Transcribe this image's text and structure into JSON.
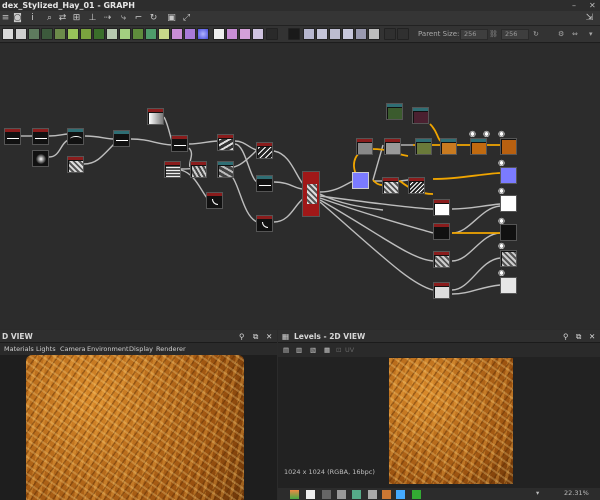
{
  "window": {
    "title": "dex_Stylized_Hay_01 - GRAPH",
    "minimize_icon": "minus-icon",
    "close_icon": "close-icon"
  },
  "toolbar2": {
    "parent_size_label": "Parent Size:",
    "width_value": "256",
    "height_value": "256"
  },
  "graph": {
    "colors": {
      "grayscale": "#8a1c1c",
      "color": "#2f6e74",
      "link": "#bdbdbd",
      "color_link": "#f0a500",
      "selected_output": "#7b7bff"
    }
  },
  "panel_3d": {
    "title": "D VIEW",
    "menu": [
      "Materials",
      "Lights",
      "Camera",
      "Environment",
      "Display",
      "Renderer"
    ]
  },
  "panel_2d": {
    "title": "Levels - 2D VIEW",
    "toolbar_label": "UV",
    "resolution": "1024 x 1024 (RGBA, 16bpc)",
    "zoom": "22.31%"
  }
}
